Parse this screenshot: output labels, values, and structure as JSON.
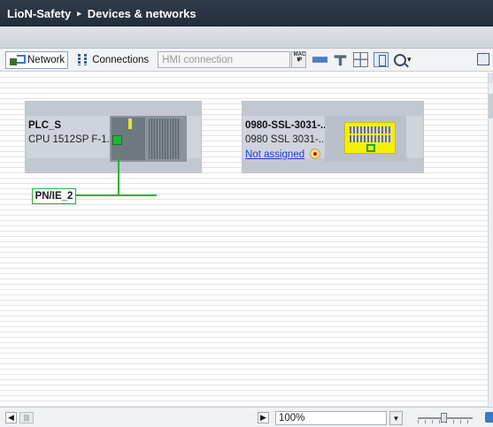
{
  "title": {
    "project": "LioN-Safety",
    "separator": "▸",
    "page": "Devices & networks"
  },
  "toolbar": {
    "network_label": "Network",
    "connections_label": "Connections",
    "connection_type_placeholder": "HMI connection",
    "icons": [
      "network-view-icon",
      "connections-icon",
      "hmi-connection-dropdown",
      "address-icon",
      "device-icon",
      "module-icon",
      "grid-icon",
      "layout-icon",
      "zoom-icon",
      "zoom-down-arrow-icon",
      "overview-icon"
    ]
  },
  "devices": [
    {
      "name": "PLC_S",
      "type": "CPU 1512SP F-1...",
      "icon": "plc-device-icon"
    },
    {
      "name": "0980-SSL-3031-...",
      "type": "0980 SSL 3031-...",
      "link": "Not assigned",
      "icon": "io-device-icon",
      "status_icon": "not-assigned-status-icon"
    }
  ],
  "network": {
    "label": "PN/IE_2",
    "line_color": "#24b33c"
  },
  "statusbar": {
    "zoom": "100%"
  },
  "colors": {
    "titlebar": "#2a3442",
    "device_box": "#cfd3dc",
    "network_green": "#24b33c",
    "io_yellow": "#f3f000",
    "link_blue": "#1a3fd6"
  }
}
